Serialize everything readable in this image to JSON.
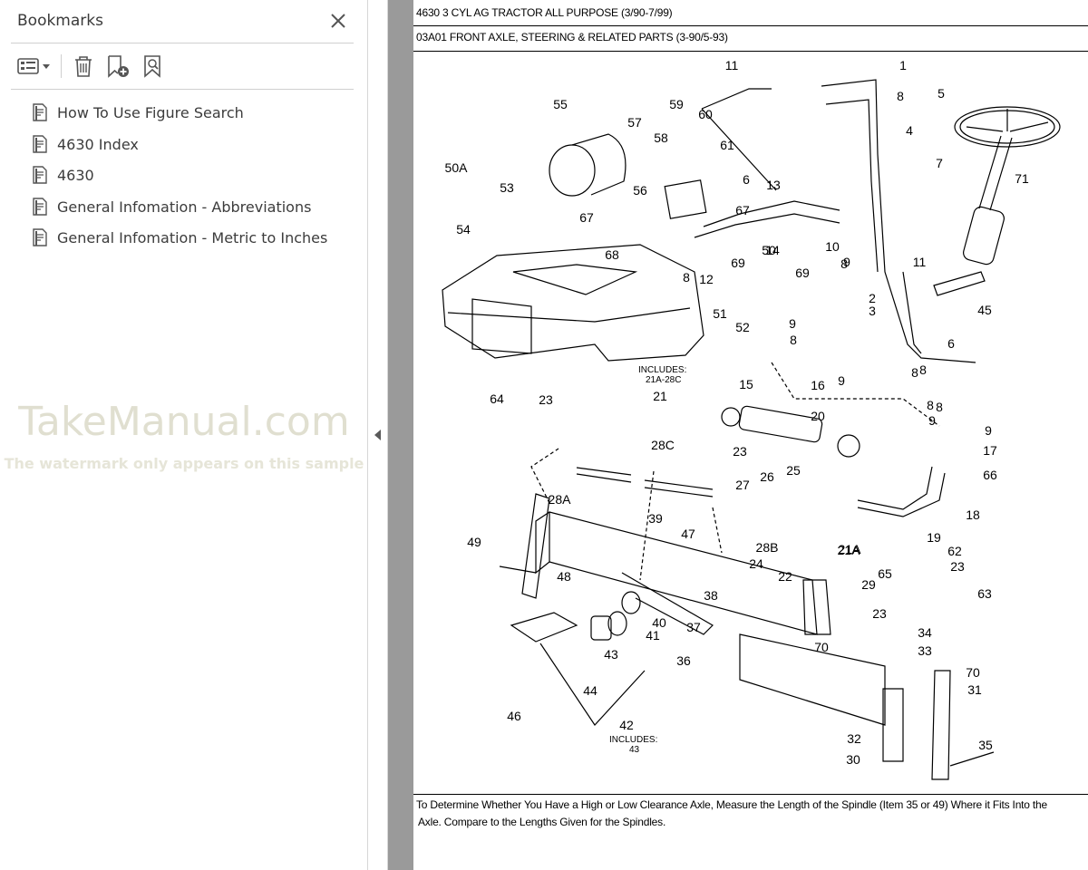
{
  "bookmarks": {
    "title": "Bookmarks",
    "close_icon": "close-icon",
    "toolbar": [
      "options-menu-icon",
      "delete-bookmark-icon",
      "add-bookmark-icon",
      "find-bookmark-icon"
    ],
    "items": [
      {
        "label": "How To Use Figure Search"
      },
      {
        "label": "4630 Index"
      },
      {
        "label": "4630"
      },
      {
        "label": "General Infomation - Abbreviations"
      },
      {
        "label": "General Infomation - Metric to Inches"
      }
    ]
  },
  "watermark": {
    "main": "TakeManual.com",
    "sub": "The watermark only appears on this sample"
  },
  "document": {
    "header1": "4630 3 CYL AG TRACTOR ALL PURPOSE (3/90-7/99)",
    "header2": "03A01 FRONT AXLE, STEERING & RELATED PARTS (3-90/5-93)",
    "callouts": [
      "11",
      "1",
      "55",
      "59",
      "60",
      "8",
      "5",
      "57",
      "58",
      "61",
      "67",
      "4",
      "7",
      "71",
      "56",
      "6",
      "13",
      "50A",
      "53",
      "67",
      "54",
      "50",
      "10",
      "14",
      "11",
      "68",
      "69",
      "12",
      "8",
      "69",
      "9",
      "2",
      "8",
      "3",
      "45",
      "51",
      "52",
      "9",
      "6",
      "8",
      "8",
      "15",
      "16",
      "9",
      "8",
      "64",
      "23",
      "21",
      "20",
      "8",
      "9",
      "9",
      "17",
      "66",
      "28C",
      "23",
      "26",
      "25",
      "27",
      "28A",
      "39",
      "47",
      "18",
      "21A",
      "49",
      "48",
      "28B",
      "19",
      "62",
      "24",
      "22",
      "23",
      "29",
      "65",
      "63",
      "38",
      "40",
      "23",
      "37",
      "41",
      "34",
      "36",
      "43",
      "70",
      "33",
      "70",
      "31",
      "46",
      "44",
      "42",
      "32",
      "35",
      "30",
      "21A",
      "8"
    ],
    "includes": [
      {
        "label": "INCLUDES:",
        "value": "21A-28C"
      },
      {
        "label": "INCLUDES:",
        "value": "43"
      }
    ],
    "caption_line1": "To Determine Whether You Have a High or Low Clearance Axle, Measure the Length of the Spindle (Item 35 or 49) Where it Fits Into the",
    "caption_line2": "Axle. Compare to the Lengths Given for the Spindles."
  }
}
